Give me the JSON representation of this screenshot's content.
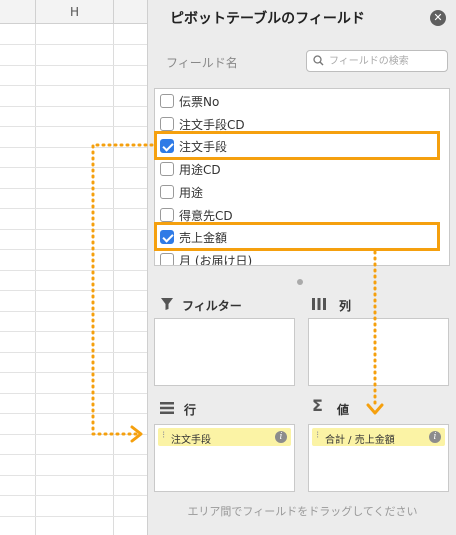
{
  "sheet": {
    "column_header": "H"
  },
  "panel": {
    "title": "ピボットテーブルのフィールド",
    "close_icon": "close-icon",
    "field_heading": "フィールド名",
    "search": {
      "placeholder": "フィールドの検索",
      "value": ""
    },
    "fields": [
      {
        "label": "伝票No",
        "checked": false
      },
      {
        "label": "注文手段CD",
        "checked": false
      },
      {
        "label": "注文手段",
        "checked": true
      },
      {
        "label": "用途CD",
        "checked": false
      },
      {
        "label": "用途",
        "checked": false
      },
      {
        "label": "得意先CD",
        "checked": false
      },
      {
        "label": "売上金額",
        "checked": true
      },
      {
        "label": "月 (お届け日)",
        "checked": false
      }
    ],
    "areas": {
      "filter": {
        "title": "フィルター",
        "icon": "filter-funnel-icon"
      },
      "columns": {
        "title": "列",
        "icon": "columns-icon"
      },
      "rows": {
        "title": "行",
        "icon": "rows-icon",
        "item": "注文手段"
      },
      "values": {
        "title": "値",
        "icon": "sigma-icon",
        "item": "合計 / 売上金額"
      }
    },
    "footer_hint": "エリア間でフィールドをドラッグしてください"
  },
  "annotations": {
    "highlight_color": "#f5a00e",
    "check_color": "#2f7be6",
    "pill_color": "#fbf3a5"
  }
}
